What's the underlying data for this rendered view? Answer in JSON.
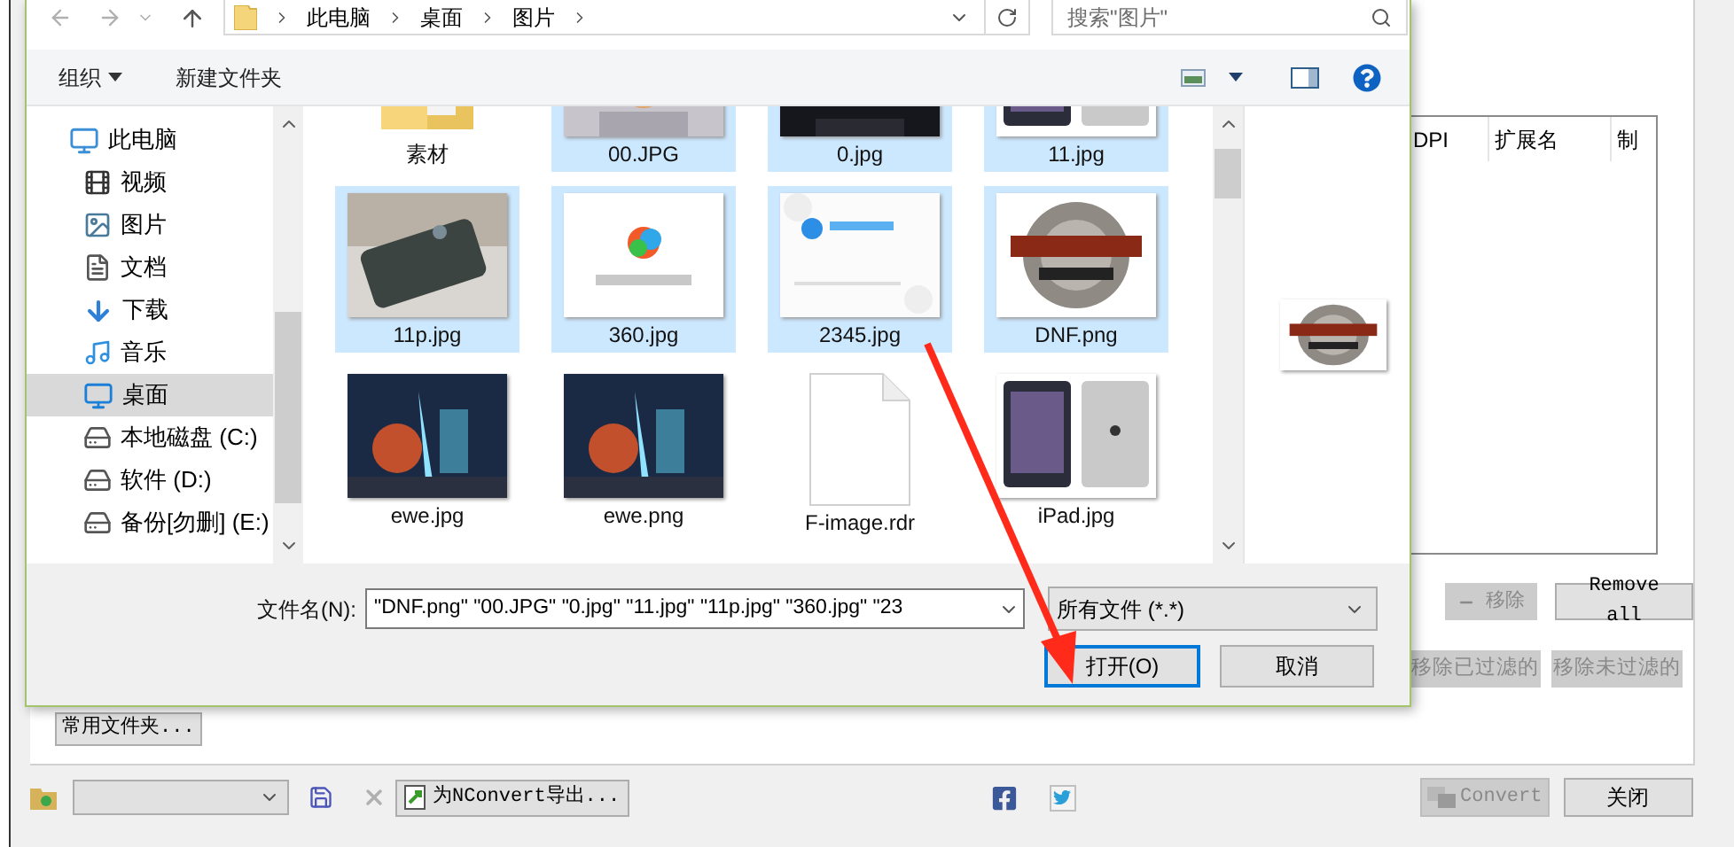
{
  "dialog": {
    "address": {
      "path": [
        "此电脑",
        "桌面",
        "图片"
      ]
    },
    "search": {
      "placeholder": "搜索\"图片\""
    },
    "toolbar": {
      "organize": "组织",
      "new_folder": "新建文件夹"
    },
    "nav": [
      {
        "label": "此电脑",
        "kind": "computer",
        "selected": false,
        "children": [
          {
            "label": "视频",
            "kind": "video",
            "selected": false
          },
          {
            "label": "图片",
            "kind": "pictures",
            "selected": false
          },
          {
            "label": "文档",
            "kind": "documents",
            "selected": false
          },
          {
            "label": "下载",
            "kind": "downloads",
            "selected": false
          },
          {
            "label": "音乐",
            "kind": "music",
            "selected": false
          },
          {
            "label": "桌面",
            "kind": "desktop",
            "selected": true
          },
          {
            "label": "本地磁盘 (C:)",
            "kind": "system-drive",
            "selected": false
          },
          {
            "label": "软件 (D:)",
            "kind": "drive",
            "selected": false
          },
          {
            "label": "备份[勿删] (E:)",
            "kind": "drive",
            "selected": false
          }
        ]
      }
    ],
    "files": [
      {
        "name": "素材",
        "kind": "folder",
        "selected": false
      },
      {
        "name": "00.JPG",
        "kind": "picture",
        "selected": true
      },
      {
        "name": "0.jpg",
        "kind": "picture",
        "selected": true
      },
      {
        "name": "11.jpg",
        "kind": "picture",
        "selected": true
      },
      {
        "name": "11p.jpg",
        "kind": "picture",
        "selected": true
      },
      {
        "name": "360.jpg",
        "kind": "picture",
        "selected": true
      },
      {
        "name": "2345.jpg",
        "kind": "picture",
        "selected": true
      },
      {
        "name": "DNF.png",
        "kind": "picture",
        "selected": true
      },
      {
        "name": "ewe.jpg",
        "kind": "picture",
        "selected": false
      },
      {
        "name": "ewe.png",
        "kind": "picture",
        "selected": false
      },
      {
        "name": "F-image.rdr",
        "kind": "document",
        "selected": false
      },
      {
        "name": "iPad.jpg",
        "kind": "picture",
        "selected": false
      }
    ],
    "filename": {
      "label": "文件名(N):",
      "value": "\"DNF.png\" \"00.JPG\" \"0.jpg\" \"11.jpg\" \"11p.jpg\" \"360.jpg\" \"23"
    },
    "filter": "所有文件 (*.*)",
    "open": "打开(O)",
    "cancel": "取消"
  },
  "app": {
    "columns": [
      "DPI",
      "扩展名",
      "制"
    ],
    "list_buttons": [
      {
        "label": "移除",
        "kind": "minus",
        "disabled": true
      },
      {
        "label": "Remove all",
        "kind": "mono",
        "disabled": false
      }
    ],
    "filter_buttons": [
      {
        "label": "移除已过滤的",
        "disabled": true
      },
      {
        "label": "移除未过滤的",
        "disabled": true
      }
    ],
    "favorites": "常用文件夹...",
    "export": "为NConvert导出...",
    "convert": {
      "label": "Convert",
      "disabled": true
    },
    "close": "关闭"
  }
}
